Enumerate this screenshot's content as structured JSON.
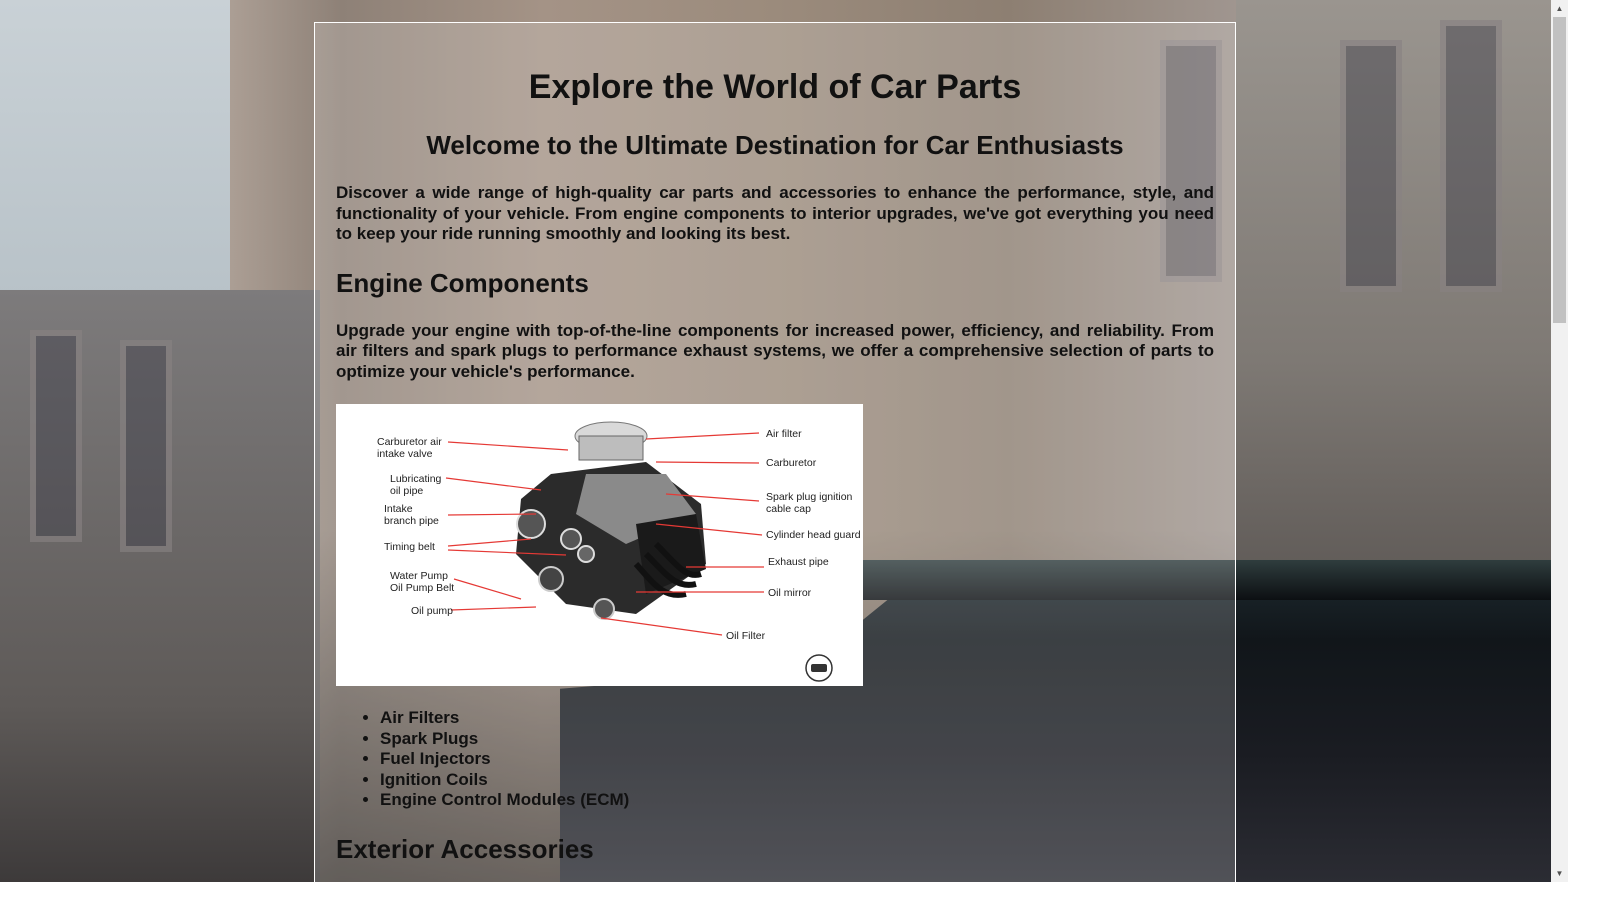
{
  "page": {
    "title": "Explore the World of Car Parts",
    "subtitle": "Welcome to the Ultimate Destination for Car Enthusiasts",
    "intro": "Discover a wide range of high-quality car parts and accessories to enhance the performance, style, and functionality of your vehicle. From engine components to interior upgrades, we've got everything you need to keep your ride running smoothly and looking its best."
  },
  "engine": {
    "heading": "Engine Components",
    "text": "Upgrade your engine with top-of-the-line components for increased power, efficiency, and reliability. From air filters and spark plugs to performance exhaust systems, we offer a comprehensive selection of parts to optimize your vehicle's performance.",
    "diagram_labels": {
      "carb_air_intake_1": "Carburetor air",
      "carb_air_intake_2": "intake valve",
      "lub_1": "Lubricating",
      "lub_2": "oil pipe",
      "intake_1": "Intake",
      "intake_2": "branch pipe",
      "timing": "Timing belt",
      "water_pump_1": "Water Pump",
      "water_pump_2": "Oil Pump Belt",
      "oil_pump": "Oil pump",
      "air_filter": "Air filter",
      "carburetor": "Carburetor",
      "spark_cap_1": "Spark plug ignition",
      "spark_cap_2": "cable cap",
      "cyl_head": "Cylinder head guard",
      "exhaust": "Exhaust pipe",
      "oil_mirror": "Oil mirror",
      "oil_filter": "Oil Filter"
    },
    "items": [
      "Air Filters",
      "Spark Plugs",
      "Fuel Injectors",
      "Ignition Coils",
      "Engine Control Modules (ECM)"
    ]
  },
  "exterior": {
    "heading": "Exterior Accessories"
  },
  "colors": {
    "label_line": "#e53935",
    "text": "#111111"
  }
}
